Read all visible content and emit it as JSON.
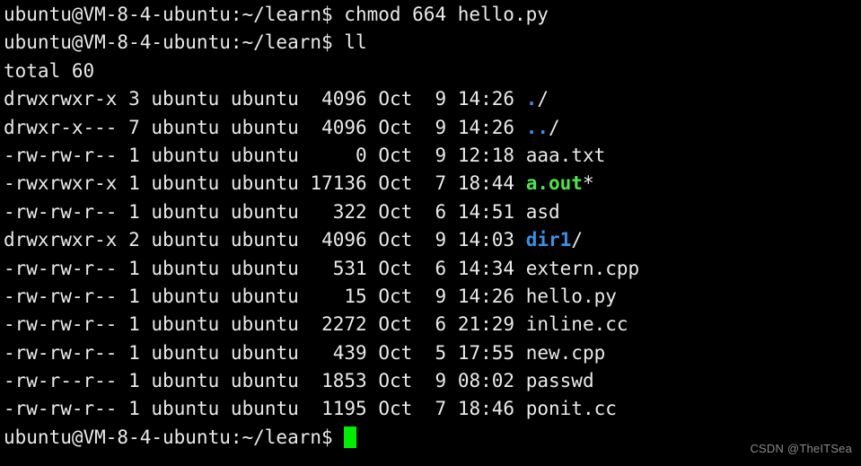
{
  "terminal": {
    "background_color": "#000000",
    "foreground_color": "#eaeaea",
    "dir_color": "#3b8fe8",
    "exec_color": "#4ee44e",
    "cursor_color": "#00ee00",
    "prompt": "ubuntu@VM-8-4-ubuntu:~/learn$",
    "commands": {
      "first": " chmod 664 hello.py",
      "second": " ll"
    },
    "total_line": "total 60",
    "listing": [
      {
        "perms": "drwxrwxr-x",
        "links": "3",
        "owner": "ubuntu",
        "group": "ubuntu",
        "size": " 4096",
        "month": "Oct",
        "day": " 9",
        "time": "14:26",
        "name": "./",
        "name_base": ".",
        "indicator": "/",
        "type": "dir"
      },
      {
        "perms": "drwxr-x---",
        "links": "7",
        "owner": "ubuntu",
        "group": "ubuntu",
        "size": " 4096",
        "month": "Oct",
        "day": " 9",
        "time": "14:26",
        "name": "../",
        "name_base": "..",
        "indicator": "/",
        "type": "dir"
      },
      {
        "perms": "-rw-rw-r--",
        "links": "1",
        "owner": "ubuntu",
        "group": "ubuntu",
        "size": "    0",
        "month": "Oct",
        "day": " 9",
        "time": "12:18",
        "name": "aaa.txt",
        "name_base": "aaa.txt",
        "indicator": "",
        "type": "file"
      },
      {
        "perms": "-rwxrwxr-x",
        "links": "1",
        "owner": "ubuntu",
        "group": "ubuntu",
        "size": "17136",
        "month": "Oct",
        "day": " 7",
        "time": "18:44",
        "name": "a.out*",
        "name_base": "a.out",
        "indicator": "*",
        "type": "exec"
      },
      {
        "perms": "-rw-rw-r--",
        "links": "1",
        "owner": "ubuntu",
        "group": "ubuntu",
        "size": "  322",
        "month": "Oct",
        "day": " 6",
        "time": "14:51",
        "name": "asd",
        "name_base": "asd",
        "indicator": "",
        "type": "file"
      },
      {
        "perms": "drwxrwxr-x",
        "links": "2",
        "owner": "ubuntu",
        "group": "ubuntu",
        "size": " 4096",
        "month": "Oct",
        "day": " 9",
        "time": "14:03",
        "name": "dir1/",
        "name_base": "dir1",
        "indicator": "/",
        "type": "dir"
      },
      {
        "perms": "-rw-rw-r--",
        "links": "1",
        "owner": "ubuntu",
        "group": "ubuntu",
        "size": "  531",
        "month": "Oct",
        "day": " 6",
        "time": "14:34",
        "name": "extern.cpp",
        "name_base": "extern.cpp",
        "indicator": "",
        "type": "file"
      },
      {
        "perms": "-rw-rw-r--",
        "links": "1",
        "owner": "ubuntu",
        "group": "ubuntu",
        "size": "   15",
        "month": "Oct",
        "day": " 9",
        "time": "14:26",
        "name": "hello.py",
        "name_base": "hello.py",
        "indicator": "",
        "type": "file"
      },
      {
        "perms": "-rw-rw-r--",
        "links": "1",
        "owner": "ubuntu",
        "group": "ubuntu",
        "size": " 2272",
        "month": "Oct",
        "day": " 6",
        "time": "21:29",
        "name": "inline.cc",
        "name_base": "inline.cc",
        "indicator": "",
        "type": "file"
      },
      {
        "perms": "-rw-rw-r--",
        "links": "1",
        "owner": "ubuntu",
        "group": "ubuntu",
        "size": "  439",
        "month": "Oct",
        "day": " 5",
        "time": "17:55",
        "name": "new.cpp",
        "name_base": "new.cpp",
        "indicator": "",
        "type": "file"
      },
      {
        "perms": "-rw-r--r--",
        "links": "1",
        "owner": "ubuntu",
        "group": "ubuntu",
        "size": " 1853",
        "month": "Oct",
        "day": " 9",
        "time": "08:02",
        "name": "passwd",
        "name_base": "passwd",
        "indicator": "",
        "type": "file"
      },
      {
        "perms": "-rw-rw-r--",
        "links": "1",
        "owner": "ubuntu",
        "group": "ubuntu",
        "size": " 1195",
        "month": "Oct",
        "day": " 7",
        "time": "18:46",
        "name": "ponit.cc",
        "name_base": "ponit.cc",
        "indicator": "",
        "type": "file"
      }
    ],
    "cursor": "block-cursor"
  },
  "watermark": {
    "text": "CSDN @TheITSea"
  }
}
